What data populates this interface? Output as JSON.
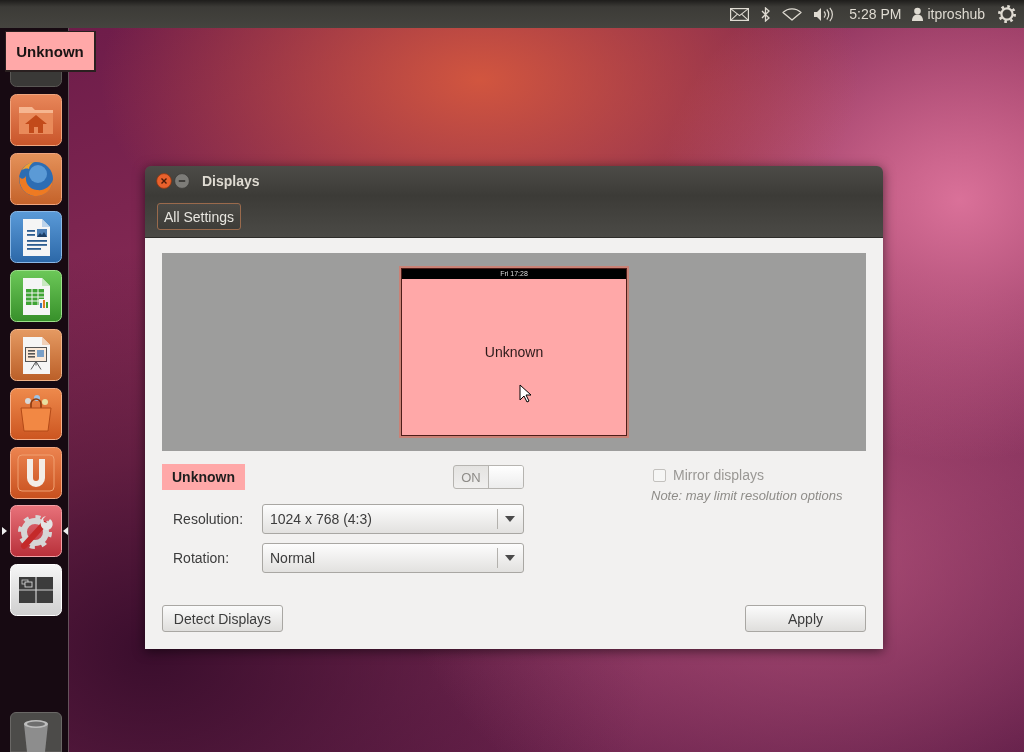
{
  "top_panel": {
    "clock": "5:28 PM",
    "user": "itproshub"
  },
  "launcher": {
    "items": [
      {
        "kind": "dash",
        "running": false,
        "focused": false
      },
      {
        "kind": "home",
        "running": false,
        "focused": false
      },
      {
        "kind": "browser",
        "running": false,
        "focused": false
      },
      {
        "kind": "writer",
        "running": false,
        "focused": false
      },
      {
        "kind": "calc",
        "running": false,
        "focused": false
      },
      {
        "kind": "impress",
        "running": false,
        "focused": false
      },
      {
        "kind": "store",
        "running": false,
        "focused": false
      },
      {
        "kind": "cloud",
        "running": false,
        "focused": false
      },
      {
        "kind": "settings",
        "running": true,
        "focused": true
      },
      {
        "kind": "workspaces",
        "running": false,
        "focused": false
      },
      {
        "kind": "trash",
        "running": false,
        "focused": false
      }
    ]
  },
  "screen_overlay": {
    "label": "Unknown"
  },
  "window": {
    "title": "Displays",
    "toolbar_button": "All Settings"
  },
  "preview": {
    "monitors": [
      {
        "label": "Unknown",
        "clock": "Fri 17:28",
        "color": "#ffa8a8"
      }
    ]
  },
  "display": {
    "label": "Unknown",
    "power": {
      "label": "ON",
      "on": true
    }
  },
  "mirror": {
    "label": "Mirror displays",
    "checked": false,
    "disabled": true,
    "note": "Note: may limit resolution options"
  },
  "fields": [
    {
      "label": "Resolution:",
      "value": "1024 x 768 (4:3)"
    },
    {
      "label": "Rotation:",
      "value": "Normal"
    }
  ],
  "buttons": [
    {
      "label": "Detect Displays"
    },
    {
      "label": "Apply"
    }
  ]
}
